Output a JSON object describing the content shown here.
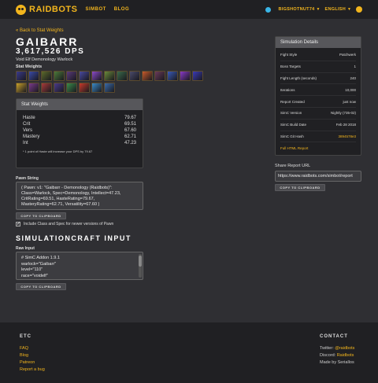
{
  "nav": {
    "brand": "RAIDBOTS",
    "links": [
      "SIMBOT",
      "BLOG"
    ],
    "user": "BIGSHOTNUT74",
    "language": "ENGLISH",
    "accent": "#f2b51d"
  },
  "back_link": "« Back to Stat Weights",
  "character": {
    "name": "GAIBARR",
    "dps": "3,617,526 DPS",
    "spec": "Void Elf Demonology Warlock"
  },
  "stat_weights_label": "Stat Weights",
  "talent_icons": [
    "#3a3a8c",
    "#3a4aa8",
    "#5c6a2a",
    "#4c7a3a",
    "#5a3a7a",
    "#4a4aa0",
    "#8a4ac8",
    "#6a8a3a",
    "#3a6a4a",
    "#4a4a6a",
    "#c85a2a",
    "#6a3a5a",
    "#3a5ab8",
    "#8a3ac8",
    "#3a3ab8",
    "#c8a02a",
    "#7a3a8a",
    "#a83a3a",
    "#4a3a8a",
    "#3a8a4a",
    "#c83a2a",
    "#3a8ac8",
    "#3a6aa8"
  ],
  "stat_weights_panel": {
    "title": "Stat Weights",
    "rows": [
      {
        "stat": "Haste",
        "value": "79.67"
      },
      {
        "stat": "Crit",
        "value": "69.51"
      },
      {
        "stat": "Vers",
        "value": "67.60"
      },
      {
        "stat": "Mastery",
        "value": "62.71"
      },
      {
        "stat": "Int",
        "value": "47.23"
      }
    ],
    "note": "* 1 point of Haste will increase your DPS by 79.67"
  },
  "pawn": {
    "label": "Pawn String",
    "lines": [
      "( Pawn: v1: \"Gaibarr - Demonology (Raidbots)\":",
      "Class=Warlock, Spec=Demonology, Intellect=47.23,",
      "CritRating=69.51, HasteRating=79.67,",
      "MasteryRating=62.71, Versatility=67.60 )"
    ],
    "copy_button": "COPY TO CLIPBOARD",
    "checkbox_label": "Include Class and Spec for newer versions of Pawn"
  },
  "simc": {
    "title": "SIMULATIONCRAFT INPUT",
    "raw_label": "Raw Input",
    "lines": [
      "# SimC Addon 1.9.1",
      "warlock=\"Gaibarr\"",
      "level=\"110\"",
      "race=\"voidelf\""
    ],
    "copy_button": "COPY TO CLIPBOARD"
  },
  "sim_details": {
    "title": "Simulation Details",
    "rows": [
      {
        "k": "Fight Style",
        "v": "Patchwerk"
      },
      {
        "k": "Boss Targets",
        "v": "1"
      },
      {
        "k": "Fight Length (seconds)",
        "v": "240"
      },
      {
        "k": "Iterations",
        "v": "10,000"
      },
      {
        "k": "Report Created",
        "v": "just now"
      },
      {
        "k": "SimC Version",
        "v": "Nightly (735-02)"
      },
      {
        "k": "SimC Build Date",
        "v": "Feb 28 2018"
      },
      {
        "k": "SimC Git Hash",
        "v": "3894578e3"
      }
    ],
    "full_report": "Full HTML Report"
  },
  "share": {
    "label": "Share Report URL",
    "url": "https://www.raidbots.com/simbot/report",
    "copy_button": "COPY TO CLIPBOARD"
  },
  "footer": {
    "etc_title": "ETC",
    "etc_links": [
      "FAQ",
      "Blog",
      "Patreon",
      "Report a bug"
    ],
    "contact_title": "CONTACT",
    "twitter_label": "Twitter:",
    "twitter": "@raidbots",
    "discord_label": "Discord:",
    "discord": "Raidbots",
    "made_by": "Made by Seriallos"
  }
}
